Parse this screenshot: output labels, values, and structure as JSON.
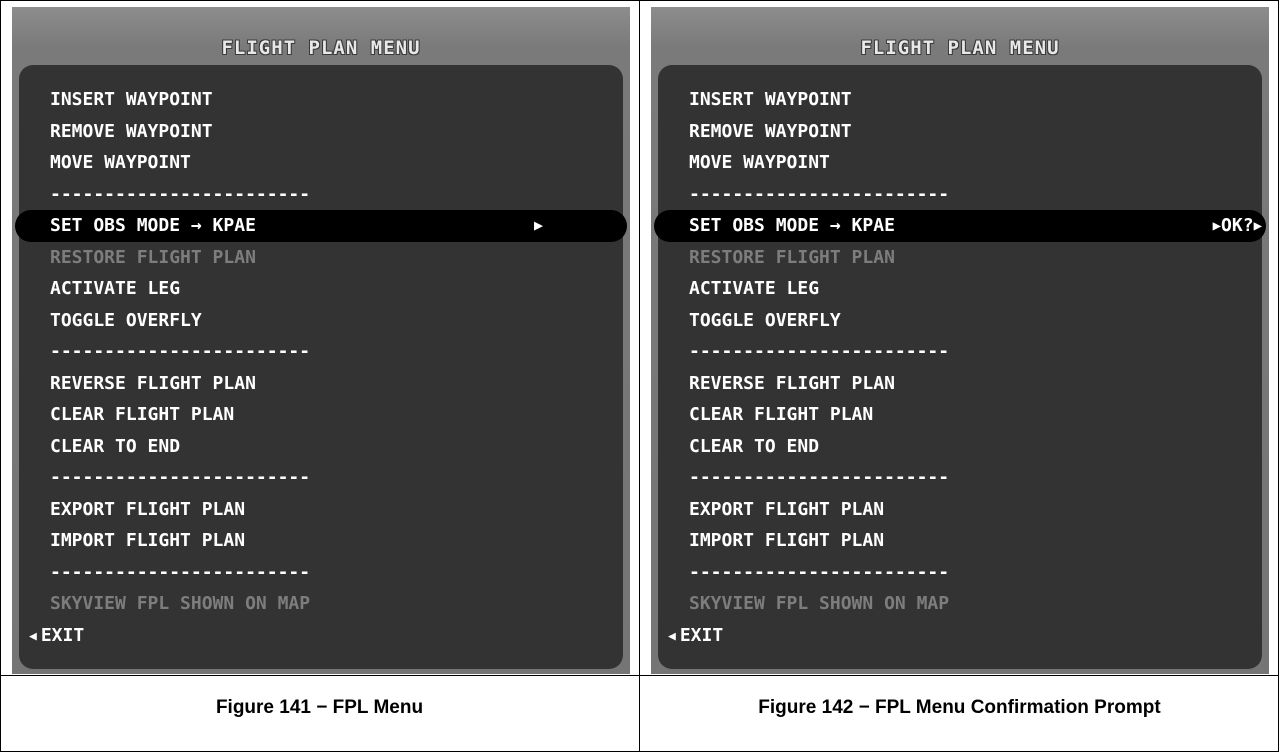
{
  "figures": [
    {
      "title": "FLIGHT PLAN MENU",
      "caption": "Figure 141 − FPL Menu",
      "items": [
        {
          "label": "INSERT WAYPOINT",
          "state": "normal"
        },
        {
          "label": "REMOVE WAYPOINT",
          "state": "normal"
        },
        {
          "label": "MOVE WAYPOINT",
          "state": "normal"
        },
        {
          "label": "------------------------",
          "state": "separator"
        },
        {
          "label": "SET OBS MODE → KPAE",
          "state": "selected",
          "suffix": "▶"
        },
        {
          "label": "RESTORE FLIGHT PLAN",
          "state": "disabled"
        },
        {
          "label": "ACTIVATE LEG",
          "state": "normal"
        },
        {
          "label": "TOGGLE OVERFLY",
          "state": "normal"
        },
        {
          "label": "------------------------",
          "state": "separator"
        },
        {
          "label": "REVERSE FLIGHT PLAN",
          "state": "normal"
        },
        {
          "label": "CLEAR FLIGHT PLAN",
          "state": "normal"
        },
        {
          "label": "CLEAR TO END",
          "state": "normal"
        },
        {
          "label": "------------------------",
          "state": "separator"
        },
        {
          "label": "EXPORT FLIGHT PLAN",
          "state": "normal"
        },
        {
          "label": "IMPORT FLIGHT PLAN",
          "state": "normal"
        },
        {
          "label": "------------------------",
          "state": "separator"
        },
        {
          "label": "SKYVIEW FPL SHOWN ON MAP",
          "state": "disabled"
        },
        {
          "label": "EXIT",
          "state": "exit"
        }
      ]
    },
    {
      "title": "FLIGHT PLAN MENU",
      "caption": "Figure 142 − FPL Menu Confirmation Prompt",
      "items": [
        {
          "label": "INSERT WAYPOINT",
          "state": "normal"
        },
        {
          "label": "REMOVE WAYPOINT",
          "state": "normal"
        },
        {
          "label": "MOVE WAYPOINT",
          "state": "normal"
        },
        {
          "label": "------------------------",
          "state": "separator"
        },
        {
          "label": "SET OBS MODE → KPAE",
          "state": "selected",
          "suffix": "OK?"
        },
        {
          "label": "RESTORE FLIGHT PLAN",
          "state": "disabled"
        },
        {
          "label": "ACTIVATE LEG",
          "state": "normal"
        },
        {
          "label": "TOGGLE OVERFLY",
          "state": "normal"
        },
        {
          "label": "------------------------",
          "state": "separator"
        },
        {
          "label": "REVERSE FLIGHT PLAN",
          "state": "normal"
        },
        {
          "label": "CLEAR FLIGHT PLAN",
          "state": "normal"
        },
        {
          "label": "CLEAR TO END",
          "state": "normal"
        },
        {
          "label": "------------------------",
          "state": "separator"
        },
        {
          "label": "EXPORT FLIGHT PLAN",
          "state": "normal"
        },
        {
          "label": "IMPORT FLIGHT PLAN",
          "state": "normal"
        },
        {
          "label": "------------------------",
          "state": "separator"
        },
        {
          "label": "SKYVIEW FPL SHOWN ON MAP",
          "state": "disabled"
        },
        {
          "label": "EXIT",
          "state": "exit"
        }
      ]
    }
  ]
}
